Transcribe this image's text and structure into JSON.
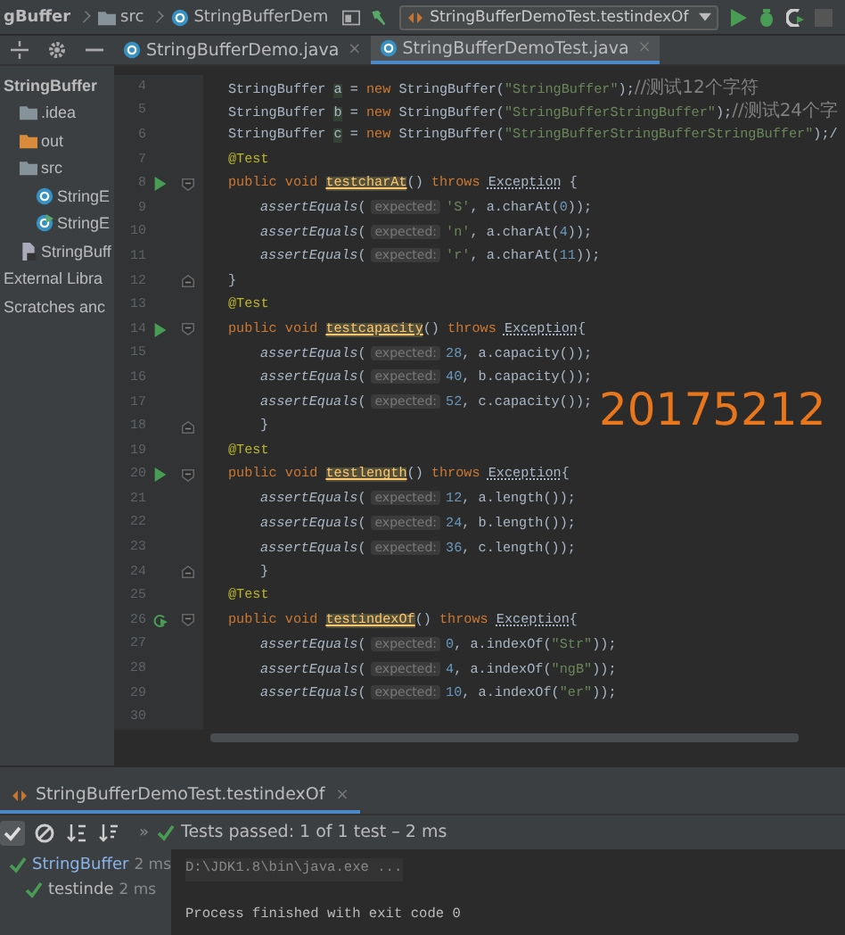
{
  "navbar": {
    "breadcrumbs": [
      {
        "label": "gBuffer"
      },
      {
        "kind": "folder",
        "label": "src"
      },
      {
        "kind": "class",
        "label": "StringBufferDem"
      }
    ],
    "run_config": "StringBufferDemoTest.testindexOf"
  },
  "project_tree": [
    {
      "label": "StringBuffer",
      "bold": true,
      "children": [
        {
          "label": ".idea",
          "kind": "folder"
        },
        {
          "label": "out",
          "kind": "folder-orange"
        },
        {
          "label": "src",
          "kind": "folder",
          "children": [
            {
              "label": "StringE",
              "kind": "class"
            },
            {
              "label": "StringE",
              "kind": "test-class"
            }
          ]
        },
        {
          "label": "StringBuff",
          "kind": "module"
        }
      ]
    },
    {
      "label": "External Libra"
    },
    {
      "label": "Scratches anc"
    }
  ],
  "tabs": [
    {
      "label": "StringBufferDemo.java",
      "close": "×",
      "selected": false
    },
    {
      "label": "StringBufferDemoTest.java",
      "close": "×",
      "selected": true
    }
  ],
  "editor": {
    "lines": [
      {
        "number": "4",
        "kind": "member",
        "tokens": [
          {
            "kind": "plain",
            "t": "StringBuffer "
          },
          {
            "kind": "var",
            "t": "a"
          },
          {
            "kind": "plain",
            "t": " = "
          },
          {
            "kind": "kw",
            "t": "new "
          },
          {
            "kind": "plain",
            "t": "StringBuffer("
          },
          {
            "kind": "str",
            "t": "\"StringBuffer\""
          },
          {
            "kind": "plain",
            "t": ");"
          },
          {
            "kind": "comment",
            "t": "//测试12个字符"
          }
        ]
      },
      {
        "number": "5",
        "kind": "member",
        "tokens": [
          {
            "kind": "plain",
            "t": "StringBuffer "
          },
          {
            "kind": "var",
            "t": "b"
          },
          {
            "kind": "plain",
            "t": " = "
          },
          {
            "kind": "kw",
            "t": "new "
          },
          {
            "kind": "plain",
            "t": "StringBuffer("
          },
          {
            "kind": "str",
            "t": "\"StringBufferStringBuffer\""
          },
          {
            "kind": "plain",
            "t": ");"
          },
          {
            "kind": "comment",
            "t": "//测试24个字"
          }
        ]
      },
      {
        "number": "6",
        "kind": "member",
        "tokens": [
          {
            "kind": "plain",
            "t": "StringBuffer "
          },
          {
            "kind": "var",
            "t": "c"
          },
          {
            "kind": "plain",
            "t": " = "
          },
          {
            "kind": "kw",
            "t": "new "
          },
          {
            "kind": "plain",
            "t": "StringBuffer("
          },
          {
            "kind": "str",
            "t": "\"StringBufferStringBufferStringBuffer\""
          },
          {
            "kind": "plain",
            "t": ");/"
          }
        ]
      },
      {
        "number": "7",
        "kind": "member",
        "tokens": [
          {
            "kind": "ann",
            "t": "@Test"
          }
        ]
      },
      {
        "number": "8",
        "kind": "member",
        "gutter": {
          "kind": "run"
        },
        "fold": {
          "kind": "start"
        },
        "tokens": [
          {
            "kind": "kw",
            "t": "public void "
          },
          {
            "kind": "decl",
            "t": "testcharAt"
          },
          {
            "kind": "plain",
            "t": "() "
          },
          {
            "kind": "kw",
            "t": "throws "
          },
          {
            "kind": "exc",
            "t": "Exception"
          },
          {
            "kind": "plain",
            "t": " {"
          }
        ]
      },
      {
        "number": "9",
        "kind": "statement",
        "tokens": [
          {
            "kind": "italic",
            "t": "assertEquals"
          },
          {
            "kind": "plain",
            "t": "("
          },
          {
            "kind": "hint",
            "t": "expected:"
          },
          {
            "kind": "str",
            "t": "'S'"
          },
          {
            "kind": "plain",
            "t": ", a.charAt("
          },
          {
            "kind": "num",
            "t": "0"
          },
          {
            "kind": "plain",
            "t": "));"
          }
        ]
      },
      {
        "number": "10",
        "kind": "statement",
        "tokens": [
          {
            "kind": "italic",
            "t": "assertEquals"
          },
          {
            "kind": "plain",
            "t": "("
          },
          {
            "kind": "hint",
            "t": "expected:"
          },
          {
            "kind": "str",
            "t": "'n'"
          },
          {
            "kind": "plain",
            "t": ", a.charAt("
          },
          {
            "kind": "num",
            "t": "4"
          },
          {
            "kind": "plain",
            "t": "));"
          }
        ]
      },
      {
        "number": "11",
        "kind": "statement",
        "tokens": [
          {
            "kind": "italic",
            "t": "assertEquals"
          },
          {
            "kind": "plain",
            "t": "("
          },
          {
            "kind": "hint",
            "t": "expected:"
          },
          {
            "kind": "str",
            "t": "'r'"
          },
          {
            "kind": "plain",
            "t": ", a.charAt("
          },
          {
            "kind": "num",
            "t": "11"
          },
          {
            "kind": "plain",
            "t": "));"
          }
        ]
      },
      {
        "number": "12",
        "kind": "member",
        "fold": {
          "kind": "end"
        },
        "tokens": [
          {
            "kind": "plain",
            "t": "}"
          }
        ]
      },
      {
        "number": "13",
        "kind": "member",
        "tokens": [
          {
            "kind": "ann",
            "t": "@Test"
          }
        ]
      },
      {
        "number": "14",
        "kind": "member",
        "gutter": {
          "kind": "run"
        },
        "fold": {
          "kind": "start"
        },
        "tokens": [
          {
            "kind": "kw",
            "t": "public void "
          },
          {
            "kind": "decl",
            "t": "testcapacity"
          },
          {
            "kind": "plain",
            "t": "() "
          },
          {
            "kind": "kw",
            "t": "throws "
          },
          {
            "kind": "exc",
            "t": "Exception"
          },
          {
            "kind": "plain",
            "t": "{"
          }
        ]
      },
      {
        "number": "15",
        "kind": "statement",
        "tokens": [
          {
            "kind": "italic",
            "t": "assertEquals"
          },
          {
            "kind": "plain",
            "t": "("
          },
          {
            "kind": "hint",
            "t": "expected:"
          },
          {
            "kind": "num",
            "t": "28"
          },
          {
            "kind": "plain",
            "t": ", a.capacity());"
          }
        ]
      },
      {
        "number": "16",
        "kind": "statement",
        "tokens": [
          {
            "kind": "italic",
            "t": "assertEquals"
          },
          {
            "kind": "plain",
            "t": "("
          },
          {
            "kind": "hint",
            "t": "expected:"
          },
          {
            "kind": "num",
            "t": "40"
          },
          {
            "kind": "plain",
            "t": ", b.capacity());"
          }
        ]
      },
      {
        "number": "17",
        "kind": "statement",
        "tokens": [
          {
            "kind": "italic",
            "t": "assertEquals"
          },
          {
            "kind": "plain",
            "t": "("
          },
          {
            "kind": "hint",
            "t": "expected:"
          },
          {
            "kind": "num",
            "t": "52"
          },
          {
            "kind": "plain",
            "t": ", c.capacity());"
          }
        ]
      },
      {
        "number": "18",
        "kind": "statement",
        "fold": {
          "kind": "end"
        },
        "tokens": [
          {
            "kind": "plain",
            "t": "}"
          }
        ]
      },
      {
        "number": "19",
        "kind": "member",
        "tokens": [
          {
            "kind": "ann",
            "t": "@Test"
          }
        ]
      },
      {
        "number": "20",
        "kind": "member",
        "gutter": {
          "kind": "run"
        },
        "fold": {
          "kind": "start"
        },
        "tokens": [
          {
            "kind": "kw",
            "t": "public void "
          },
          {
            "kind": "decl",
            "t": "testlength"
          },
          {
            "kind": "plain",
            "t": "() "
          },
          {
            "kind": "kw",
            "t": "throws "
          },
          {
            "kind": "exc",
            "t": "Exception"
          },
          {
            "kind": "plain",
            "t": "{"
          }
        ]
      },
      {
        "number": "21",
        "kind": "statement",
        "tokens": [
          {
            "kind": "italic",
            "t": "assertEquals"
          },
          {
            "kind": "plain",
            "t": "("
          },
          {
            "kind": "hint",
            "t": "expected:"
          },
          {
            "kind": "num",
            "t": "12"
          },
          {
            "kind": "plain",
            "t": ", a.length());"
          }
        ]
      },
      {
        "number": "22",
        "kind": "statement",
        "tokens": [
          {
            "kind": "italic",
            "t": "assertEquals"
          },
          {
            "kind": "plain",
            "t": "("
          },
          {
            "kind": "hint",
            "t": "expected:"
          },
          {
            "kind": "num",
            "t": "24"
          },
          {
            "kind": "plain",
            "t": ", b.length());"
          }
        ]
      },
      {
        "number": "23",
        "kind": "statement",
        "tokens": [
          {
            "kind": "italic",
            "t": "assertEquals"
          },
          {
            "kind": "plain",
            "t": "("
          },
          {
            "kind": "hint",
            "t": "expected:"
          },
          {
            "kind": "num",
            "t": "36"
          },
          {
            "kind": "plain",
            "t": ", c.length());"
          }
        ]
      },
      {
        "number": "24",
        "kind": "statement",
        "fold": {
          "kind": "end"
        },
        "tokens": [
          {
            "kind": "plain",
            "t": "}"
          }
        ]
      },
      {
        "number": "25",
        "kind": "member",
        "tokens": [
          {
            "kind": "ann",
            "t": "@Test"
          }
        ]
      },
      {
        "number": "26",
        "kind": "member",
        "gutter": {
          "kind": "rerun"
        },
        "fold": {
          "kind": "start"
        },
        "tokens": [
          {
            "kind": "kw",
            "t": "public void "
          },
          {
            "kind": "decl",
            "t": "testindexOf"
          },
          {
            "kind": "plain",
            "t": "() "
          },
          {
            "kind": "kw",
            "t": "throws "
          },
          {
            "kind": "exc",
            "t": "Exception"
          },
          {
            "kind": "plain",
            "t": "{"
          }
        ]
      },
      {
        "number": "27",
        "kind": "statement",
        "tokens": [
          {
            "kind": "italic",
            "t": "assertEquals"
          },
          {
            "kind": "plain",
            "t": "("
          },
          {
            "kind": "hint",
            "t": "expected:"
          },
          {
            "kind": "num",
            "t": "0"
          },
          {
            "kind": "plain",
            "t": ", a.indexOf("
          },
          {
            "kind": "str",
            "t": "\"Str\""
          },
          {
            "kind": "plain",
            "t": "));"
          }
        ]
      },
      {
        "number": "28",
        "kind": "statement",
        "tokens": [
          {
            "kind": "italic",
            "t": "assertEquals"
          },
          {
            "kind": "plain",
            "t": "("
          },
          {
            "kind": "hint",
            "t": "expected:"
          },
          {
            "kind": "num",
            "t": "4"
          },
          {
            "kind": "plain",
            "t": ", a.indexOf("
          },
          {
            "kind": "str",
            "t": "\"ngB\""
          },
          {
            "kind": "plain",
            "t": "));"
          }
        ]
      },
      {
        "number": "29",
        "kind": "statement",
        "tokens": [
          {
            "kind": "italic",
            "t": "assertEquals"
          },
          {
            "kind": "plain",
            "t": "("
          },
          {
            "kind": "hint",
            "t": "expected:"
          },
          {
            "kind": "num",
            "t": "10"
          },
          {
            "kind": "plain",
            "t": ", a.indexOf("
          },
          {
            "kind": "str",
            "t": "\"er\""
          },
          {
            "kind": "plain",
            "t": "));"
          }
        ]
      },
      {
        "number": "30"
      }
    ]
  },
  "overlay_text": "20175212",
  "run_panel": {
    "tab": {
      "label": "StringBufferDemoTest.testindexOf",
      "close": "×"
    },
    "more": "»",
    "status": "Tests passed: 1 of 1 test – 2 ms",
    "results": [
      {
        "label": "StringBuffer",
        "time": "2 ms",
        "passed": true,
        "children": [
          {
            "label": "testinde",
            "time": "2 ms",
            "passed": true
          }
        ]
      }
    ],
    "console": [
      {
        "kind": "command",
        "text": "D:\\JDK1.8\\bin\\java.exe ..."
      },
      {
        "kind": "output",
        "text": "Process finished with exit code 0"
      }
    ]
  }
}
